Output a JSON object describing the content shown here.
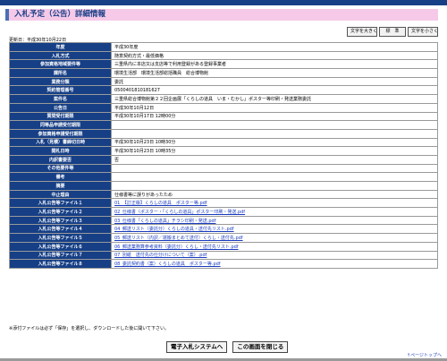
{
  "page": {
    "title": "入札予定（公告）詳細情報",
    "updated": "更新日：平成30年10月22日"
  },
  "size_buttons": {
    "larger": "文字を大きく",
    "standard": "標　準",
    "smaller": "文字を小さく"
  },
  "rows": [
    {
      "label": "年度",
      "value": "平成30年度"
    },
    {
      "label": "入札方式",
      "value": "随意契約方式・最低価格"
    },
    {
      "label": "参加資格地域要件等",
      "value": "三重県内に本店又は支店等で利用登録がある登録事業者"
    },
    {
      "label": "課所名",
      "value": "環境生活部　環境生活部総括職員　総合博物館"
    },
    {
      "label": "業務分類",
      "value": "委託"
    },
    {
      "label": "契約管理番号",
      "value": "0500401810181627"
    },
    {
      "label": "案件名",
      "value": "三重県総合博物館第２２回企画展「くらしの道具　いま・むかし」ポスター等印刷・発送業務委託"
    },
    {
      "label": "公告日",
      "value": "平成30年10月12日"
    },
    {
      "label": "質問受付期限",
      "value": "平成30年10月17日 12時00分"
    },
    {
      "label": "同等品申請受付期限",
      "value": ""
    },
    {
      "label": "参加資格申請受付期限",
      "value": ""
    },
    {
      "label": "入札（見積）書締切日時",
      "value": "平成30年10月23日 10時30分"
    },
    {
      "label": "開札日時",
      "value": "平成30年10月23日 10時35分"
    },
    {
      "label": "内訳書要否",
      "value": "否"
    },
    {
      "label": "その他要件等",
      "value": ""
    },
    {
      "label": "備考",
      "value": ""
    },
    {
      "label": "摘要",
      "value": ""
    },
    {
      "label": "中止理由",
      "value": "仕様書等に誤りがあったため"
    }
  ],
  "files": [
    {
      "label": "入札公告等ファイル１",
      "value": "01_【訂正版】くらしの道具　ポスター等.pdf"
    },
    {
      "label": "入札公告等ファイル２",
      "value": "02_仕様書（ポスター・「くらしの道具」ポスター印刷・発送.pdf"
    },
    {
      "label": "入札公告等ファイル３",
      "value": "03_仕様書「くらしの道具」チラシ印刷・発送.pdf"
    },
    {
      "label": "入札公告等ファイル４",
      "value": "04_郵送リスト（委託分）くらしの道具・送付先リスト.pdf"
    },
    {
      "label": "入札公告等ファイル５",
      "value": "05_郵送リスト（内訳／運搬まとめて送付）くらし・送付先.pdf"
    },
    {
      "label": "入札公告等ファイル６",
      "value": "06_郵送業務算参考資料（委託分）くらし・送付先リスト.pdf"
    },
    {
      "label": "入札公告等ファイル７",
      "value": "07_別紙　送付先の仕分けについて（案）.pdf"
    },
    {
      "label": "入札公告等ファイル８",
      "value": "08_委託契約書（案）くらしの道具　ポスター等.pdf"
    }
  ],
  "note": "※添付ファイルは必ず「保存」を選択し、ダウンロードした後に開いて下さい。",
  "bottom_buttons": {
    "system": "電子入札システムへ",
    "close": "この画面を閉じる"
  },
  "page_top": "↑ページトップへ"
}
